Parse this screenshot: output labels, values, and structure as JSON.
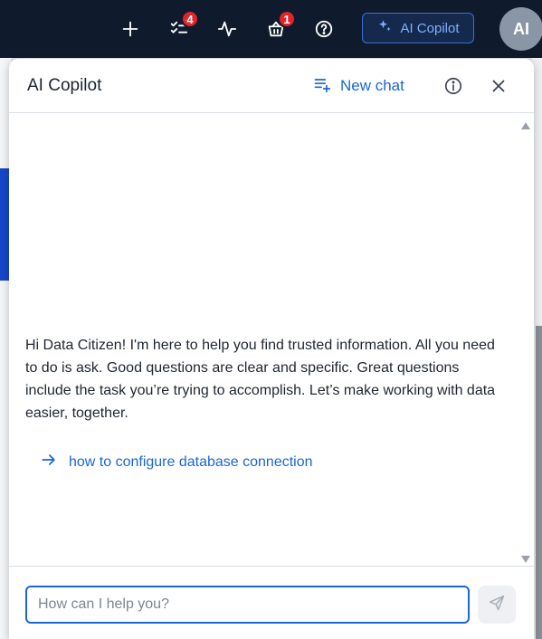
{
  "topbar": {
    "tasks_badge": "4",
    "basket_badge": "1",
    "copilot_label": "AI Copilot",
    "avatar_initials": "AI",
    "icons": [
      "plus-icon",
      "tasks-icon",
      "activity-icon",
      "basket-icon",
      "help-icon",
      "sparkle-icon"
    ]
  },
  "panel": {
    "title": "AI Copilot",
    "new_chat_label": "New chat",
    "welcome_text": "Hi Data Citizen! I'm here to help you find trusted information. All you need to do is ask. Good questions are clear and specific. Great questions include the task you’re trying to accomplish. Let’s make working with data easier, together.",
    "suggestion": "how to configure database connection",
    "input_placeholder": "How can I help you?",
    "input_value": ""
  },
  "colors": {
    "accent": "#1a66d6",
    "topbar_bg": "#0f1b2d",
    "badge": "#e0242a"
  }
}
